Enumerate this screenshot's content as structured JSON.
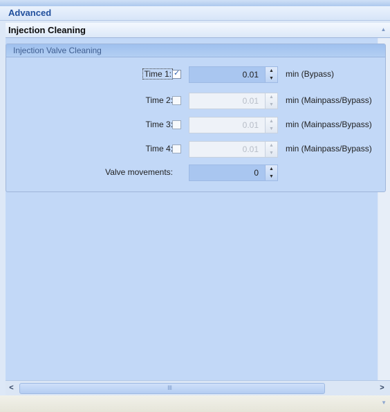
{
  "panel": {
    "title": "Advanced"
  },
  "section": {
    "title": "Injection Cleaning"
  },
  "group": {
    "title": "Injection Valve Cleaning"
  },
  "rows": [
    {
      "label": "Time 1:",
      "checked": true,
      "value": "0.01",
      "unit": "min (Bypass)"
    },
    {
      "label": "Time 2:",
      "checked": false,
      "value": "0.01",
      "unit": "min (Mainpass/Bypass)"
    },
    {
      "label": "Time 3:",
      "checked": false,
      "value": "0.01",
      "unit": "min (Mainpass/Bypass)"
    },
    {
      "label": "Time 4:",
      "checked": false,
      "value": "0.01",
      "unit": "min (Mainpass/Bypass)"
    }
  ],
  "valve_movements": {
    "label": "Valve movements:",
    "value": "0"
  },
  "icons": {
    "check": "✓",
    "spin_up": "▲",
    "spin_down": "▼",
    "scroll_left": "<",
    "scroll_right": ">",
    "grip": "IIII"
  },
  "colors": {
    "accent": "#a9c6f0",
    "header_text": "#1f4e9c",
    "background": "#c2d8f7"
  }
}
